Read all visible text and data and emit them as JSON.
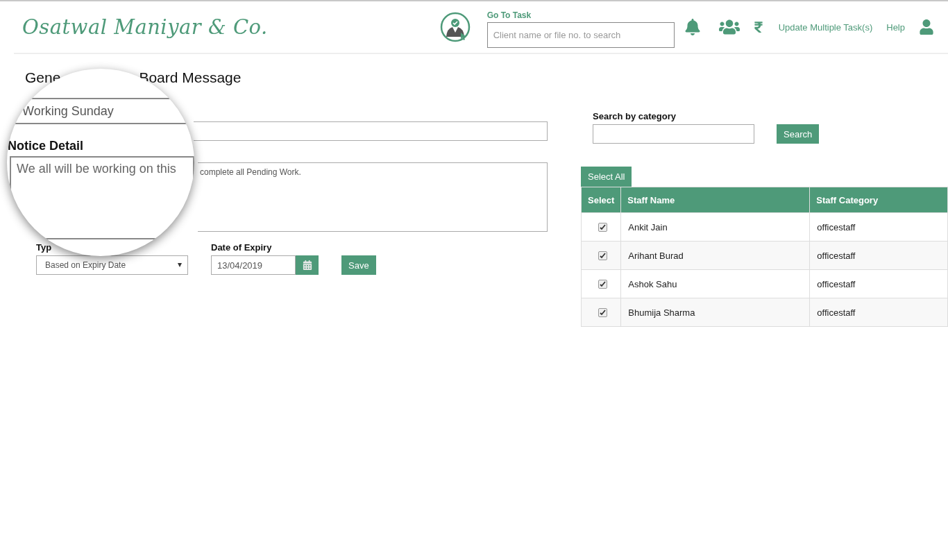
{
  "header": {
    "brand": "Osatwal Maniyar & Co.",
    "go_to_task": {
      "label": "Go To Task",
      "placeholder": "Client name or file no. to search"
    },
    "links": [
      "Update Multiple Task(s)",
      "Help"
    ]
  },
  "title_parts": [
    "Gene",
    "Board Message"
  ],
  "form": {
    "detail_visible": "complete all Pending Work.",
    "type": {
      "label": "Typ",
      "value": "Based on Expiry Date"
    },
    "expiry": {
      "label": "Date of Expiry",
      "value": "13/04/2019"
    },
    "save": "Save"
  },
  "magnifier": {
    "subject_value": "Working Sunday",
    "detail_label": "Notice Detail",
    "detail_value": "We all will be working on this"
  },
  "category_search": {
    "label": "Search by category",
    "button": "Search"
  },
  "select_all": "Select All",
  "table": {
    "columns": [
      "Select",
      "Staff Name",
      "Staff Category"
    ],
    "rows": [
      {
        "checked": true,
        "name": "Ankit Jain",
        "category": "officestaff"
      },
      {
        "checked": true,
        "name": "Arihant Burad",
        "category": "officestaff"
      },
      {
        "checked": true,
        "name": "Ashok Sahu",
        "category": "officestaff"
      },
      {
        "checked": true,
        "name": "Bhumija Sharma",
        "category": "officestaff"
      }
    ]
  }
}
